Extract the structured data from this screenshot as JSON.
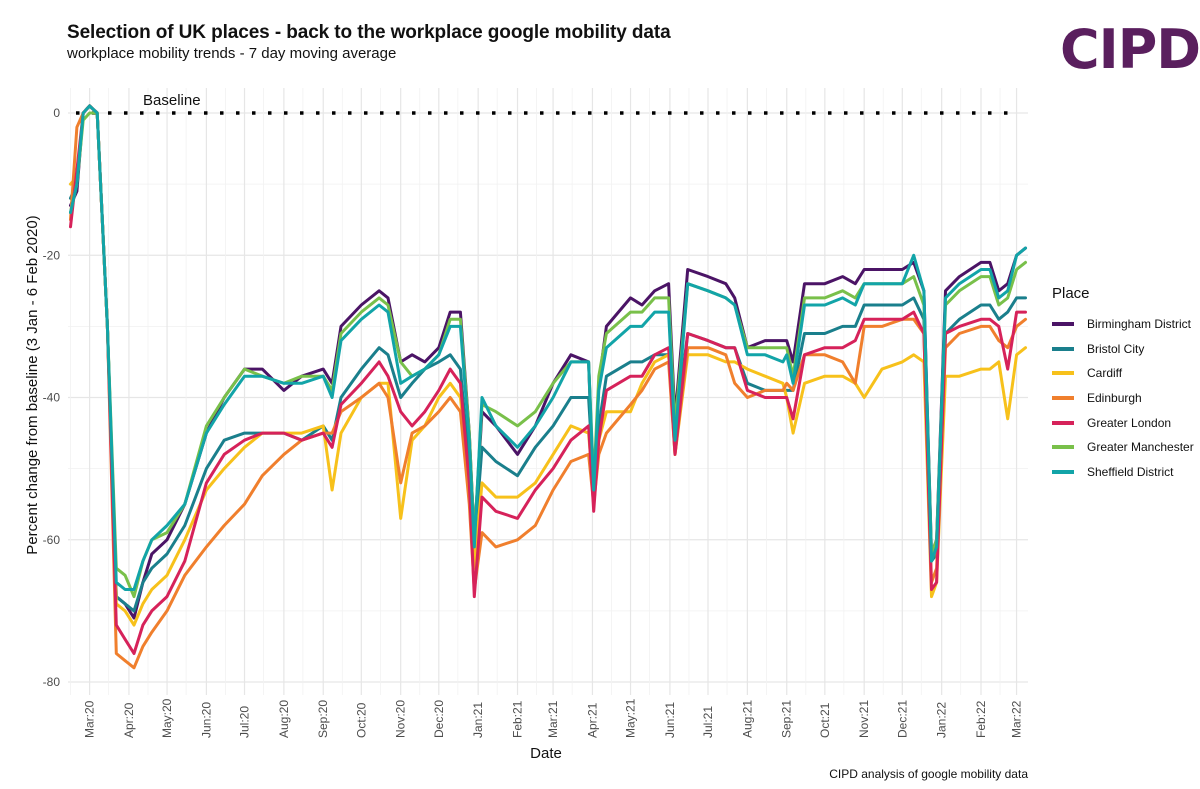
{
  "header": {
    "title": "Selection of UK places - back to the workplace google mobility data",
    "subtitle": "workplace mobility trends - 7 day moving average",
    "logo": "CIPD"
  },
  "caption": "CIPD analysis of google mobility data",
  "chart_data": {
    "type": "line",
    "title": "Selection of UK places - back to the workplace google mobility data",
    "subtitle": "workplace mobility trends - 7 day moving average",
    "xlabel": "Date",
    "ylabel": "Percent change from baseline (3 Jan - 6 Feb 2020)",
    "ylim": [
      -82,
      3
    ],
    "yticks": [
      0,
      -20,
      -40,
      -60,
      -80
    ],
    "ytick_labels": [
      "0",
      "-20",
      "-40",
      "-60",
      "-80"
    ],
    "xlim": [
      "2020-02-13",
      "2022-03-10"
    ],
    "xticks": [
      "2020-03-01",
      "2020-04-01",
      "2020-05-01",
      "2020-06-01",
      "2020-07-01",
      "2020-08-01",
      "2020-09-01",
      "2020-10-01",
      "2020-11-01",
      "2020-12-01",
      "2021-01-01",
      "2021-02-01",
      "2021-03-01",
      "2021-04-01",
      "2021-05-01",
      "2021-06-01",
      "2021-07-01",
      "2021-08-01",
      "2021-09-01",
      "2021-10-01",
      "2021-11-01",
      "2021-12-01",
      "2022-01-01",
      "2022-02-01",
      "2022-03-01"
    ],
    "xtick_labels": [
      "Mar:20",
      "Apr:20",
      "May:20",
      "Jun:20",
      "Jul:20",
      "Aug:20",
      "Sep:20",
      "Oct:20",
      "Nov:20",
      "Dec:20",
      "Jan:21",
      "Feb:21",
      "Mar:21",
      "Apr:21",
      "May:21",
      "Jun:21",
      "Jul:21",
      "Aug:21",
      "Sep:21",
      "Oct:21",
      "Nov:21",
      "Dec:21",
      "Jan:22",
      "Feb:22",
      "Mar:22"
    ],
    "grid": true,
    "legend_title": "Place",
    "legend_position": "right",
    "baseline": {
      "value": 0,
      "label": "Baseline",
      "style": "dotted"
    },
    "x": [
      "2020-02-15",
      "2020-02-20",
      "2020-02-25",
      "2020-03-01",
      "2020-03-07",
      "2020-03-15",
      "2020-03-22",
      "2020-03-29",
      "2020-04-05",
      "2020-04-12",
      "2020-04-19",
      "2020-05-01",
      "2020-05-15",
      "2020-06-01",
      "2020-06-15",
      "2020-07-01",
      "2020-07-15",
      "2020-08-01",
      "2020-08-15",
      "2020-09-01",
      "2020-09-08",
      "2020-09-15",
      "2020-10-01",
      "2020-10-15",
      "2020-10-22",
      "2020-11-01",
      "2020-11-10",
      "2020-11-20",
      "2020-12-01",
      "2020-12-10",
      "2020-12-18",
      "2020-12-25",
      "2020-12-29",
      "2021-01-04",
      "2021-01-15",
      "2021-02-01",
      "2021-02-15",
      "2021-03-01",
      "2021-03-15",
      "2021-03-29",
      "2021-04-02",
      "2021-04-06",
      "2021-04-12",
      "2021-05-01",
      "2021-05-10",
      "2021-05-20",
      "2021-05-31",
      "2021-06-05",
      "2021-06-15",
      "2021-07-01",
      "2021-07-15",
      "2021-07-22",
      "2021-08-01",
      "2021-08-15",
      "2021-08-29",
      "2021-09-01",
      "2021-09-06",
      "2021-09-15",
      "2021-10-01",
      "2021-10-15",
      "2021-10-25",
      "2021-11-01",
      "2021-11-15",
      "2021-12-01",
      "2021-12-10",
      "2021-12-18",
      "2021-12-24",
      "2021-12-28",
      "2022-01-04",
      "2022-01-15",
      "2022-02-01",
      "2022-02-08",
      "2022-02-15",
      "2022-02-22",
      "2022-03-01",
      "2022-03-08"
    ],
    "series": [
      {
        "name": "Birmingham District",
        "color": "#4b1466",
        "values": [
          -13,
          -11,
          0,
          1,
          0,
          -30,
          -68,
          -69,
          -71,
          -66,
          -62,
          -60,
          -55,
          -45,
          -40,
          -36,
          -36,
          -39,
          -37,
          -36,
          -38,
          -30,
          -27,
          -25,
          -26,
          -35,
          -34,
          -35,
          -33,
          -28,
          -28,
          -45,
          -60,
          -42,
          -44,
          -48,
          -44,
          -38,
          -34,
          -35,
          -55,
          -38,
          -30,
          -26,
          -27,
          -25,
          -24,
          -43,
          -22,
          -23,
          -24,
          -26,
          -33,
          -32,
          -32,
          -32,
          -35,
          -24,
          -24,
          -23,
          -24,
          -22,
          -22,
          -22,
          -21,
          -25,
          -62,
          -60,
          -25,
          -23,
          -21,
          -21,
          -25,
          -24,
          -20,
          -19
        ]
      },
      {
        "name": "Bristol City",
        "color": "#1a7f8c",
        "values": [
          -12,
          -10,
          0,
          1,
          0,
          -30,
          -68,
          -69,
          -70,
          -66,
          -64,
          -62,
          -58,
          -50,
          -46,
          -45,
          -45,
          -45,
          -46,
          -44,
          -46,
          -40,
          -36,
          -33,
          -34,
          -40,
          -38,
          -36,
          -35,
          -34,
          -36,
          -50,
          -61,
          -47,
          -49,
          -51,
          -47,
          -44,
          -40,
          -40,
          -52,
          -44,
          -37,
          -35,
          -35,
          -34,
          -34,
          -45,
          -31,
          -32,
          -33,
          -33,
          -38,
          -39,
          -39,
          -39,
          -39,
          -31,
          -31,
          -30,
          -30,
          -27,
          -27,
          -27,
          -26,
          -29,
          -63,
          -62,
          -31,
          -29,
          -27,
          -27,
          -29,
          -28,
          -26,
          -26
        ]
      },
      {
        "name": "Cardiff",
        "color": "#f7c11b",
        "values": [
          -10,
          -9,
          0,
          1,
          0,
          -30,
          -69,
          -70,
          -72,
          -69,
          -67,
          -65,
          -60,
          -53,
          -50,
          -47,
          -45,
          -45,
          -45,
          -44,
          -53,
          -45,
          -40,
          -38,
          -38,
          -57,
          -46,
          -44,
          -40,
          -38,
          -40,
          -52,
          -64,
          -52,
          -54,
          -54,
          -52,
          -48,
          -44,
          -45,
          -54,
          -46,
          -42,
          -42,
          -38,
          -35,
          -34,
          -48,
          -34,
          -34,
          -35,
          -35,
          -36,
          -37,
          -38,
          -40,
          -45,
          -38,
          -37,
          -37,
          -38,
          -40,
          -36,
          -35,
          -34,
          -35,
          -68,
          -66,
          -37,
          -37,
          -36,
          -36,
          -35,
          -43,
          -34,
          -33
        ]
      },
      {
        "name": "Edinburgh",
        "color": "#f07f2d",
        "values": [
          -15,
          -2,
          0,
          1,
          0,
          -30,
          -76,
          -77,
          -78,
          -75,
          -73,
          -70,
          -65,
          -61,
          -58,
          -55,
          -51,
          -48,
          -46,
          -45,
          -45,
          -42,
          -40,
          -38,
          -40,
          -52,
          -45,
          -44,
          -42,
          -40,
          -42,
          -55,
          -67,
          -59,
          -61,
          -60,
          -58,
          -53,
          -49,
          -48,
          -55,
          -48,
          -45,
          -41,
          -39,
          -36,
          -35,
          -48,
          -33,
          -33,
          -34,
          -38,
          -40,
          -39,
          -39,
          -38,
          -39,
          -34,
          -34,
          -35,
          -38,
          -30,
          -30,
          -29,
          -29,
          -31,
          -66,
          -64,
          -33,
          -31,
          -30,
          -30,
          -32,
          -33,
          -30,
          -29
        ]
      },
      {
        "name": "Greater London",
        "color": "#d6225a",
        "values": [
          -16,
          -8,
          0,
          1,
          0,
          -30,
          -72,
          -74,
          -76,
          -72,
          -70,
          -68,
          -63,
          -52,
          -48,
          -46,
          -45,
          -45,
          -46,
          -45,
          -47,
          -41,
          -38,
          -35,
          -37,
          -42,
          -44,
          -42,
          -39,
          -36,
          -38,
          -52,
          -68,
          -54,
          -56,
          -57,
          -53,
          -50,
          -46,
          -44,
          -56,
          -46,
          -39,
          -37,
          -37,
          -34,
          -33,
          -48,
          -31,
          -32,
          -33,
          -33,
          -39,
          -40,
          -40,
          -40,
          -43,
          -34,
          -33,
          -33,
          -32,
          -29,
          -29,
          -29,
          -28,
          -31,
          -67,
          -66,
          -31,
          -30,
          -29,
          -29,
          -30,
          -36,
          -28,
          -28
        ]
      },
      {
        "name": "Greater Manchester",
        "color": "#79c04a",
        "values": [
          -14,
          -10,
          -1,
          0,
          0,
          -30,
          -64,
          -65,
          -68,
          -63,
          -60,
          -59,
          -55,
          -44,
          -40,
          -36,
          -37,
          -38,
          -37,
          -37,
          -39,
          -31,
          -28,
          -26,
          -27,
          -35,
          -37,
          -36,
          -34,
          -29,
          -29,
          -45,
          -60,
          -41,
          -42,
          -44,
          -42,
          -38,
          -35,
          -35,
          -52,
          -37,
          -31,
          -28,
          -28,
          -26,
          -26,
          -44,
          -24,
          -25,
          -26,
          -27,
          -33,
          -33,
          -33,
          -33,
          -37,
          -26,
          -26,
          -25,
          -26,
          -24,
          -24,
          -24,
          -23,
          -27,
          -62,
          -60,
          -27,
          -25,
          -23,
          -23,
          -27,
          -26,
          -22,
          -21
        ]
      },
      {
        "name": "Sheffield District",
        "color": "#12a4a8",
        "values": [
          -14,
          -10,
          0,
          1,
          0,
          -30,
          -66,
          -67,
          -67,
          -63,
          -60,
          -58,
          -55,
          -45,
          -41,
          -37,
          -37,
          -38,
          -38,
          -37,
          -40,
          -32,
          -29,
          -27,
          -28,
          -38,
          -37,
          -36,
          -34,
          -30,
          -30,
          -46,
          -61,
          -40,
          -44,
          -47,
          -44,
          -40,
          -35,
          -35,
          -53,
          -39,
          -33,
          -30,
          -30,
          -28,
          -28,
          -46,
          -24,
          -25,
          -26,
          -27,
          -34,
          -34,
          -35,
          -34,
          -38,
          -27,
          -27,
          -26,
          -27,
          -24,
          -24,
          -24,
          -20,
          -25,
          -63,
          -61,
          -26,
          -24,
          -22,
          -22,
          -26,
          -25,
          -20,
          -19
        ]
      }
    ]
  }
}
